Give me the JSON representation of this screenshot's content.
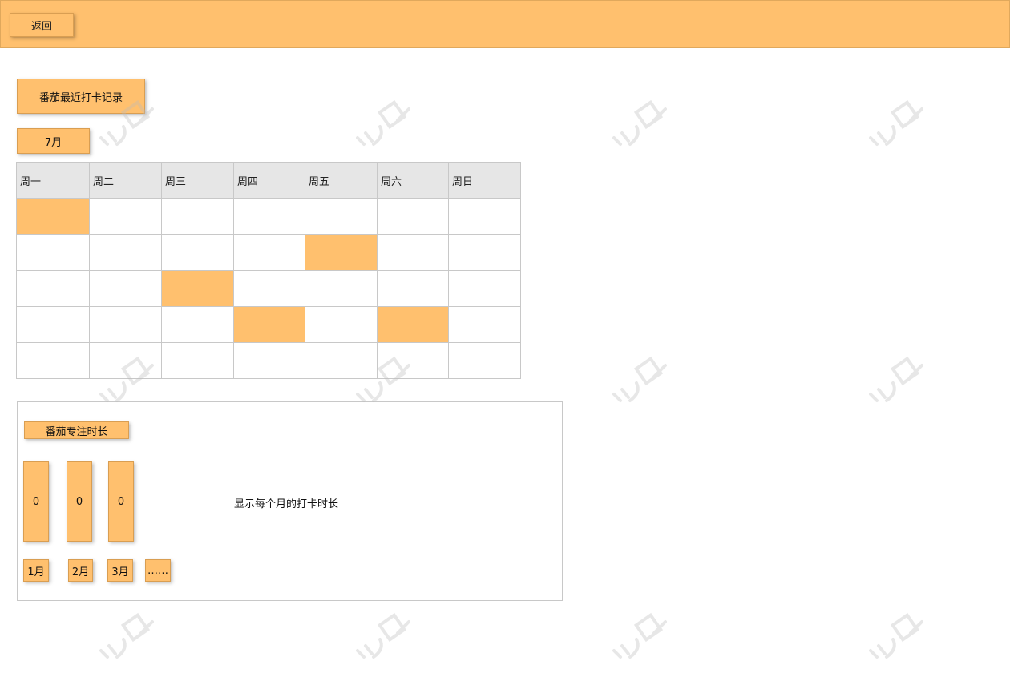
{
  "header": {
    "back_label": "返回"
  },
  "records": {
    "button_label": "番茄最近打卡记录"
  },
  "calendar": {
    "month_label": "7月",
    "weekdays": [
      "周一",
      "周二",
      "周三",
      "周四",
      "周五",
      "周六",
      "周日"
    ],
    "highlighted_cells": [
      [
        1,
        0,
        0,
        0,
        0,
        0,
        0
      ],
      [
        0,
        0,
        0,
        0,
        1,
        0,
        0
      ],
      [
        0,
        0,
        1,
        0,
        0,
        0,
        0
      ],
      [
        0,
        0,
        0,
        1,
        0,
        1,
        0
      ],
      [
        0,
        0,
        0,
        0,
        0,
        0,
        0
      ]
    ]
  },
  "focus": {
    "title": "番茄专注时长",
    "bars": [
      "0",
      "0",
      "0"
    ],
    "months": [
      "1月",
      "2月",
      "3月",
      "……"
    ],
    "hint": "显示每个月的打卡时长"
  },
  "colors": {
    "accent": "#ffc06e",
    "header_cell": "#e6e6e6",
    "border": "#c8c8c8"
  }
}
